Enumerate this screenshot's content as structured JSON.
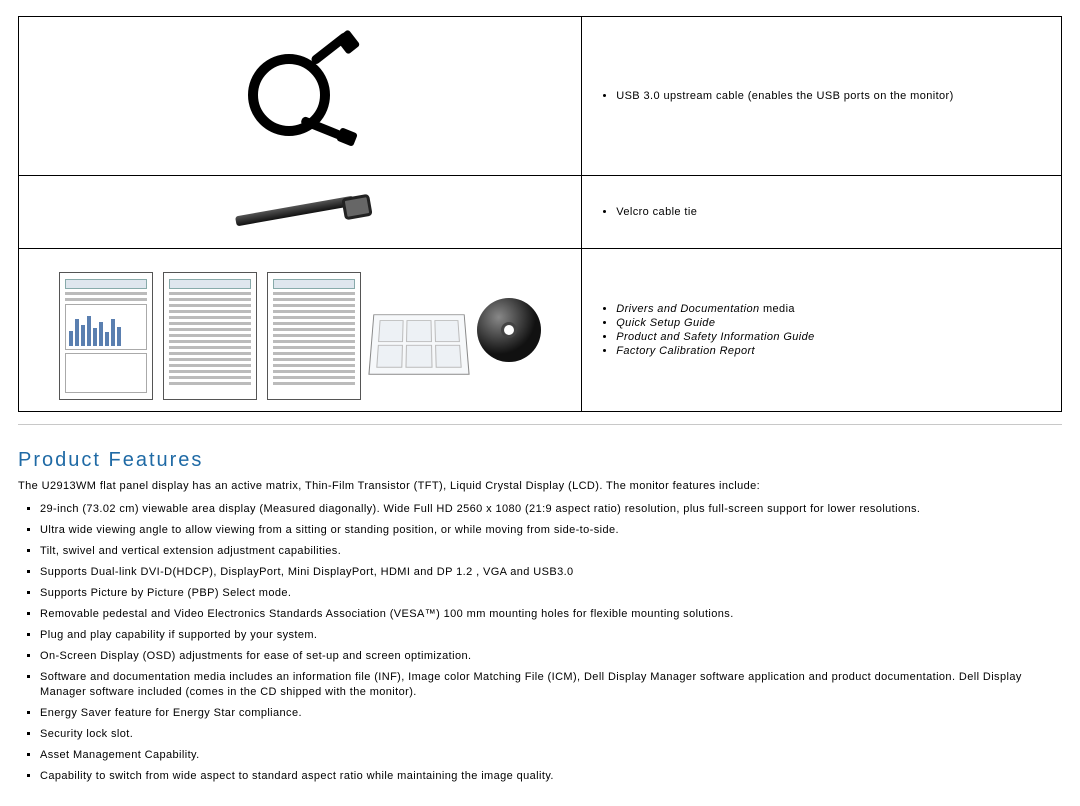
{
  "box_contents": {
    "usb_cable": "USB 3.0 upstream cable (enables the USB ports on the monitor)",
    "velcro": "Velcro cable tie",
    "docs": {
      "drivers_prefix_italic": "Drivers and Documentation",
      "drivers_suffix": " media",
      "quick_setup": "Quick Setup Guide",
      "safety_guide": "Product and Safety Information Guide",
      "calibration": "Factory Calibration Report"
    }
  },
  "section_title": "Product Features",
  "intro": "The U2913WM flat panel display has an active matrix, Thin-Film Transistor (TFT), Liquid Crystal Display (LCD). The monitor features include:",
  "features": [
    "29-inch (73.02 cm) viewable area display (Measured diagonally).  Wide Full HD 2560 x 1080 (21:9 aspect ratio) resolution, plus full-screen support for lower resolutions.",
    "Ultra wide viewing angle to allow viewing from a sitting or standing position, or while moving from side-to-side.",
    "Tilt, swivel and vertical extension adjustment capabilities.",
    "Supports Dual-link DVI-D(HDCP), DisplayPort, Mini DisplayPort, HDMI and DP 1.2 , VGA and USB3.0",
    "Supports Picture by Picture (PBP) Select mode.",
    "Removable pedestal and Video Electronics Standards Association (VESA™) 100 mm mounting holes for flexible mounting solutions.",
    "Plug and play capability if supported by your system.",
    "On-Screen Display (OSD) adjustments for ease of set-up and screen optimization.",
    "Software and documentation media includes an information file (INF), Image color Matching File (ICM), Dell Display Manager software application and product documentation. Dell Display Manager software included (comes in the CD shipped with the monitor).",
    "Energy Saver feature for Energy Star compliance.",
    "Security lock slot.",
    "Asset Management Capability.",
    "Capability to switch from wide aspect to standard aspect ratio while maintaining the image quality."
  ]
}
